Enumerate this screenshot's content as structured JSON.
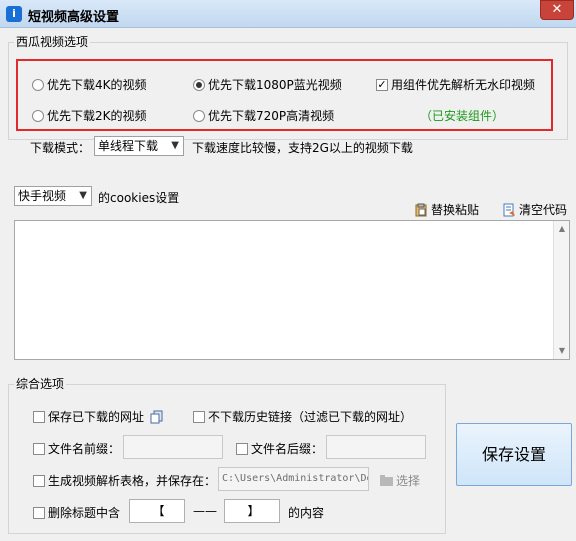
{
  "window": {
    "title": "短视频高级设置",
    "close_label": "✕"
  },
  "xigua": {
    "legend": "西瓜视频选项",
    "options": {
      "r4k": "优先下载4K的视频",
      "r1080": "优先下载1080P蓝光视频",
      "r2k": "优先下载2K的视频",
      "r720": "优先下载720P高清视频",
      "plugin": "用组件优先解析无水印视频",
      "installed": "（已安装组件）"
    },
    "selected_quality": "1080P",
    "plugin_checked": true
  },
  "download": {
    "label": "下载模式：",
    "mode": "单线程下载",
    "hint": "下载速度比较慢，支持2G以上的视频下载"
  },
  "cookies": {
    "platform": "快手视频",
    "label": "的cookies设置",
    "replace_paste": "替换粘贴",
    "clear_code": "清空代码",
    "content": ""
  },
  "general": {
    "legend": "综合选项",
    "save_downloaded_url": "保存已下载的网址",
    "no_history_link": "不下载历史链接（过滤已下载的网址）",
    "filename_prefix": "文件名前缀：",
    "filename_suffix": "文件名后缀：",
    "prefix_value": "",
    "suffix_value": "",
    "gen_table": "生成视频解析表格，并保存在：",
    "save_path": "C:\\Users\\Administrator\\De",
    "choose": "选择",
    "delete_title": "删除标题中含",
    "bracket_left": "【",
    "dash": "——",
    "bracket_right": "】",
    "content_suffix": "的内容"
  },
  "save_button": "保存设置"
}
